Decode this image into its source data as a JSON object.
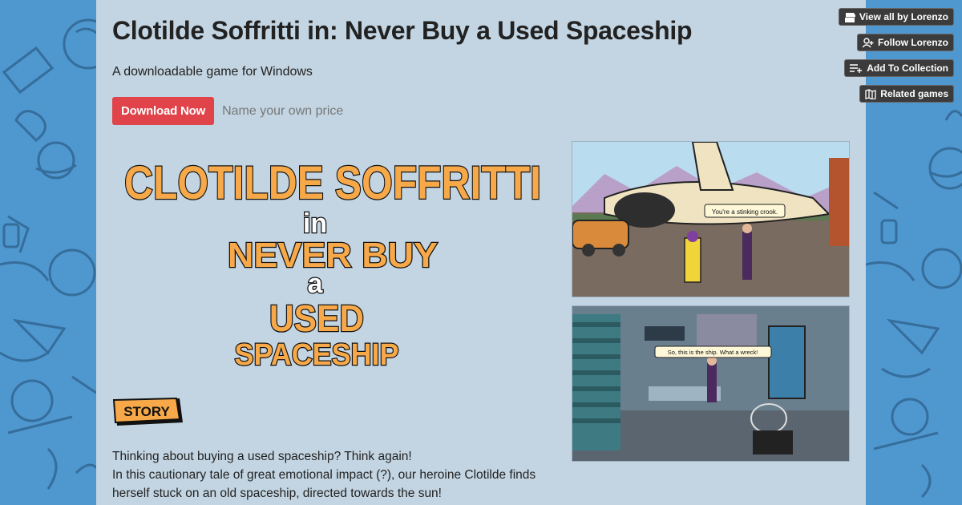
{
  "page": {
    "title": "Clotilde Soffritti in: Never Buy a Used Spaceship",
    "subtitle": "A downloadable game for Windows"
  },
  "purchase": {
    "download_label": "Download Now",
    "price_label": "Name your own price"
  },
  "logo": {
    "line1": "CLOTILDE SOFFRITTI",
    "line2": "in",
    "line3": "NEVER BUY",
    "line4": "a",
    "line5": "USED",
    "line6": "SPACESHIP"
  },
  "story_badge": "STORY",
  "description": {
    "line1": "Thinking about buying a used spaceship? Think again!",
    "line2": "In this cautionary tale of great emotional impact (?), our heroine Clotilde finds",
    "line3": "herself stuck on an old spaceship, directed towards the sun!"
  },
  "screenshots": {
    "one_caption": "You're a stinking crook.",
    "two_caption": "So, this is the ship. What a wreck!"
  },
  "nav": {
    "view_all": "View all by Lorenzo",
    "follow": "Follow Lorenzo",
    "add_collection": "Add To Collection",
    "related": "Related games"
  },
  "colors": {
    "accent": "#e0434a",
    "content_bg": "#c3d5e2",
    "side_bg": "#4f97cf",
    "logo_orange": "#f7a94a"
  },
  "icons": {
    "view_all": "itchio-icon",
    "follow": "add-user-icon",
    "add_collection": "add-to-list-icon",
    "related": "map-icon"
  }
}
